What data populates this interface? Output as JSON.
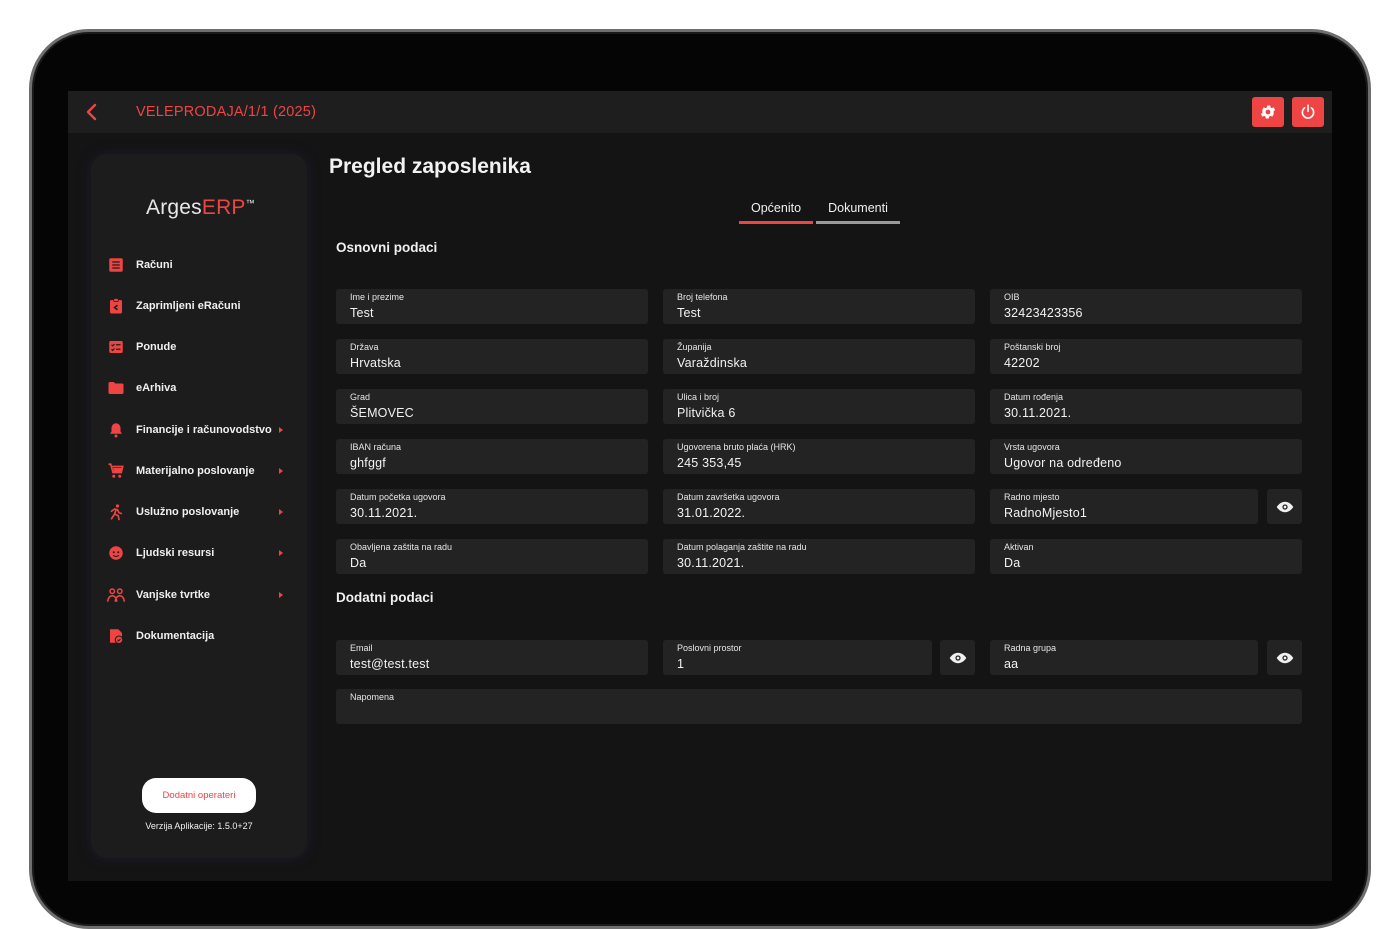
{
  "header": {
    "path": "VELEPRODAJA/1/1 (2025)"
  },
  "sidebar": {
    "logo_part1": "Arges",
    "logo_part2": "ERP",
    "logo_tm": "™",
    "items": [
      {
        "label": "Računi",
        "icon": "document-list-icon",
        "submenu": false
      },
      {
        "label": "Zaprimljeni eRačuni",
        "icon": "inbox-clipboard-icon",
        "submenu": false
      },
      {
        "label": "Ponude",
        "icon": "offer-checklist-icon",
        "submenu": false
      },
      {
        "label": "eArhiva",
        "icon": "folder-icon",
        "submenu": false
      },
      {
        "label": "Financije i računovodstvo",
        "icon": "bell-icon",
        "submenu": true
      },
      {
        "label": "Materijalno poslovanje",
        "icon": "cart-icon",
        "submenu": true
      },
      {
        "label": "Uslužno poslovanje",
        "icon": "running-person-icon",
        "submenu": true
      },
      {
        "label": "Ljudski resursi",
        "icon": "face-icon",
        "submenu": true
      },
      {
        "label": "Vanjske tvrtke",
        "icon": "handshake-icon",
        "submenu": true
      },
      {
        "label": "Dokumentacija",
        "icon": "shield-document-icon",
        "submenu": false
      }
    ],
    "extra_operators": "Dodatni operateri",
    "version": "Verzija Aplikacije: 1.5.0+27"
  },
  "main": {
    "title": "Pregled zaposlenika",
    "tabs": [
      "Općenito",
      "Dokumenti"
    ],
    "section_basic": "Osnovni podaci",
    "section_additional": "Dodatni podaci",
    "fields": {
      "ime": {
        "label": "Ime i prezime",
        "value": "Test"
      },
      "telefon": {
        "label": "Broj telefona",
        "value": "Test"
      },
      "oib": {
        "label": "OIB",
        "value": "32423423356"
      },
      "drzava": {
        "label": "Država",
        "value": "Hrvatska"
      },
      "zupanija": {
        "label": "Županija",
        "value": "Varaždinska"
      },
      "postanski": {
        "label": "Poštanski broj",
        "value": "42202"
      },
      "grad": {
        "label": "Grad",
        "value": "ŠEMOVEC"
      },
      "ulica": {
        "label": "Ulica i broj",
        "value": "Plitvička 6"
      },
      "rodenje": {
        "label": "Datum rođenja",
        "value": "30.11.2021."
      },
      "iban": {
        "label": "IBAN računa",
        "value": "ghfggf"
      },
      "placa": {
        "label": "Ugovorena bruto plaća (HRK)",
        "value": "245 353,45"
      },
      "vrsta": {
        "label": "Vrsta ugovora",
        "value": "Ugovor na određeno"
      },
      "pocetak": {
        "label": "Datum početka ugovora",
        "value": "30.11.2021."
      },
      "zavrsetak": {
        "label": "Datum završetka ugovora",
        "value": "31.01.2022."
      },
      "radno_mjesto": {
        "label": "Radno mjesto",
        "value": "RadnoMjesto1"
      },
      "zastita": {
        "label": "Obavljena zaštita na radu",
        "value": "Da"
      },
      "datum_zastite": {
        "label": "Datum polaganja zaštite na radu",
        "value": "30.11.2021."
      },
      "aktivan": {
        "label": "Aktivan",
        "value": "Da"
      },
      "email": {
        "label": "Email",
        "value": "test@test.test"
      },
      "prostor": {
        "label": "Poslovni prostor",
        "value": "1"
      },
      "grupa": {
        "label": "Radna grupa",
        "value": "aa"
      },
      "napomena": {
        "label": "Napomena",
        "value": ""
      }
    }
  },
  "colors": {
    "accent": "#ef4444",
    "background": "#141414",
    "panel": "#1c1c1c",
    "field": "#232323"
  }
}
